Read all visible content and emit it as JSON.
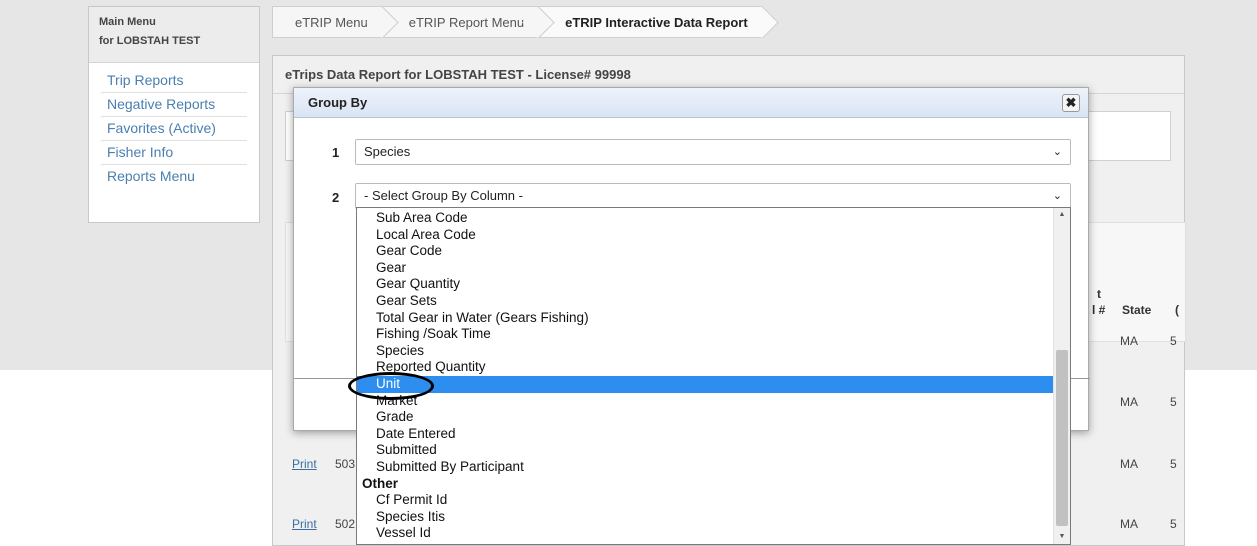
{
  "sidebar": {
    "title": "Main Menu",
    "subtitle": "for LOBSTAH TEST",
    "items": [
      "Trip Reports",
      "Negative Reports",
      "Favorites (Active)",
      "Fisher Info",
      "Reports Menu"
    ]
  },
  "breadcrumb": [
    "eTRIP Menu",
    "eTRIP Report Menu",
    "eTRIP Interactive Data Report"
  ],
  "panel": {
    "title": "eTrips Data Report for LOBSTAH TEST - License# 99998"
  },
  "table": {
    "headers": {
      "partial_a": ")",
      "partial_b": "t",
      "partial_c": "l #",
      "state": "State",
      "partial_d": "("
    },
    "rows": [
      {
        "state": "MA",
        "partial": "5"
      },
      {
        "state": "MA",
        "partial": "5"
      },
      {
        "link": "Print",
        "id": "503",
        "state": "MA",
        "partial": "5"
      },
      {
        "link": "Print",
        "id": "502",
        "state": "MA",
        "partial": "5"
      }
    ],
    "row_label": "1"
  },
  "modal": {
    "title": "Group By",
    "close": "✖",
    "row1": {
      "num": "1",
      "value": "Species"
    },
    "row2": {
      "num": "2",
      "value": "- Select Group By Column -"
    }
  },
  "dropdown": {
    "options": [
      {
        "label": "Sub Area Code"
      },
      {
        "label": "Local Area Code"
      },
      {
        "label": "Gear Code"
      },
      {
        "label": "Gear"
      },
      {
        "label": "Gear Quantity"
      },
      {
        "label": "Gear Sets"
      },
      {
        "label": "Total Gear in Water (Gears Fishing)"
      },
      {
        "label": "Fishing /Soak Time"
      },
      {
        "label": "Species"
      },
      {
        "label": "Reported Quantity"
      },
      {
        "label": "Unit",
        "selected": true
      },
      {
        "label": "Market"
      },
      {
        "label": "Grade"
      },
      {
        "label": "Date Entered"
      },
      {
        "label": "Submitted"
      },
      {
        "label": "Submitted By Participant"
      },
      {
        "label": "Other",
        "group": true
      },
      {
        "label": "Cf Permit Id"
      },
      {
        "label": "Species Itis"
      },
      {
        "label": "Vessel Id"
      }
    ]
  },
  "colors": {
    "highlight": "#2d8ef0",
    "link": "#3b6fa3"
  }
}
